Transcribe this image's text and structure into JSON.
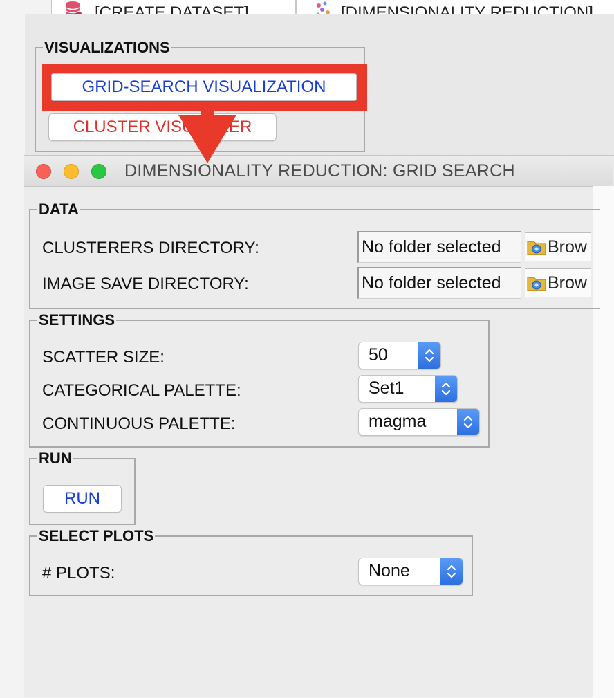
{
  "tabs": [
    {
      "label": "[CREATE DATASET]",
      "icon": "database-icon"
    },
    {
      "label": "[DIMENSIONALITY REDUCTION]",
      "icon": "scatter-icon"
    }
  ],
  "visualizations": {
    "legend": "VISUALIZATIONS",
    "grid_search_label": "GRID-SEARCH VISUALIZATION",
    "cluster_label": "CLUSTER VISUALIZER"
  },
  "window": {
    "title": "DIMENSIONALITY REDUCTION: GRID SEARCH"
  },
  "data_section": {
    "legend": "DATA",
    "clusterers_label": "CLUSTERERS DIRECTORY:",
    "clusterers_value": "No folder selected",
    "image_save_label": "IMAGE SAVE DIRECTORY:",
    "image_save_value": "No folder selected",
    "browse_label": "Brow"
  },
  "settings": {
    "legend": "SETTINGS",
    "scatter_label": "SCATTER SIZE:",
    "scatter_value": "50",
    "categorical_label": "CATEGORICAL PALETTE:",
    "categorical_value": "Set1",
    "continuous_label": "CONTINUOUS PALETTE:",
    "continuous_value": "magma"
  },
  "run": {
    "legend": "RUN",
    "button_label": "RUN"
  },
  "select_plots": {
    "legend": "SELECT PLOTS",
    "plots_label": "# PLOTS:",
    "plots_value": "None"
  },
  "colors": {
    "highlight": "#e8392b",
    "link_blue": "#1a3fd6",
    "cluster_red": "#e0312a"
  }
}
